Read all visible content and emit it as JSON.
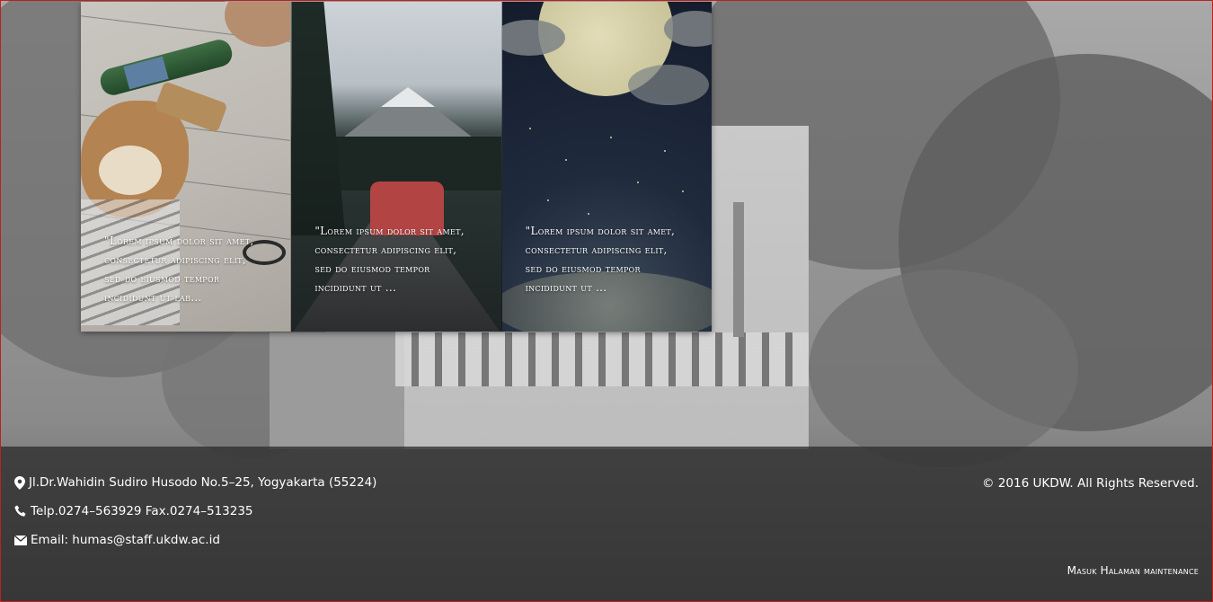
{
  "cards": [
    {
      "text": "\"Lorem ipsum dolor sit amet, consectetur adipiscing elit, sed do eiusmod tempor incididunt ut lab..."
    },
    {
      "text": "\"Lorem ipsum dolor sit amet, consectetur adipiscing elit, sed do eiusmod tempor incididunt ut ..."
    },
    {
      "text": "\"Lorem ipsum dolor sit amet, consectetur adipiscing elit, sed do eiusmod tempor incididunt ut ..."
    }
  ],
  "footer": {
    "address": "Jl.Dr.Wahidin Sudiro Husodo No.5–25, Yogyakarta (55224)",
    "phone": "Telp.0274–563929 Fax.0274–513235",
    "email": "Email: humas@staff.ukdw.ac.id",
    "copyright": "© 2016 UKDW. All Rights Reserved.",
    "maintenance_link": "Masuk Halaman maintenance"
  },
  "icons": {
    "address": "map-marker-icon",
    "phone": "phone-icon",
    "email": "envelope-icon"
  },
  "colors": {
    "footer_bg": "#2d2d2d",
    "text": "#ffffff",
    "frame_border": "#c0201c"
  }
}
